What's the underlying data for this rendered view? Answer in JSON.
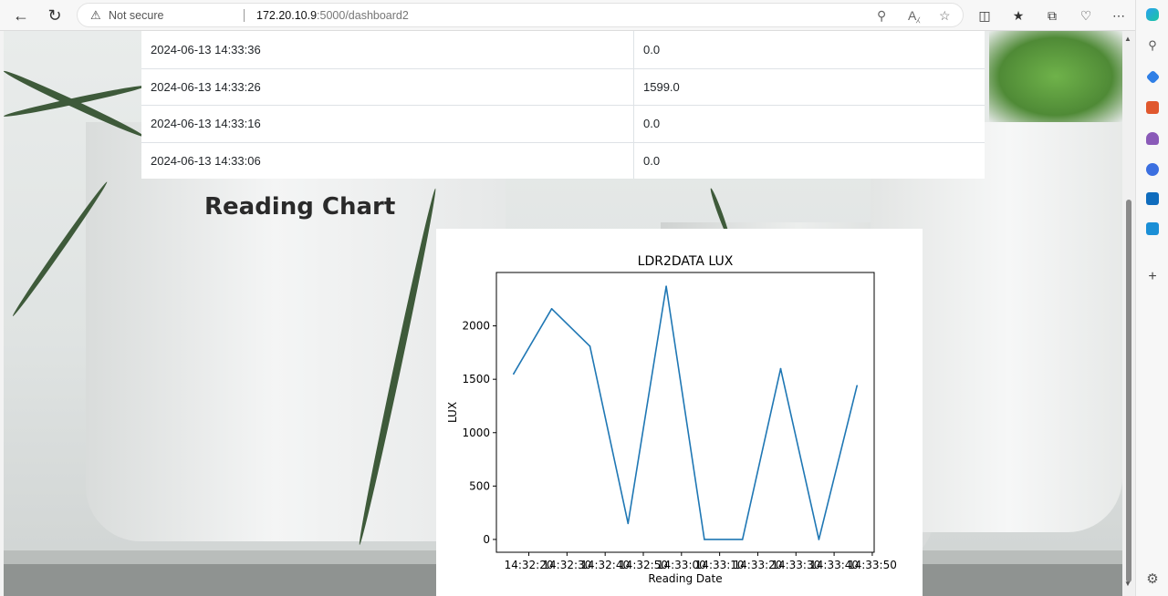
{
  "browser": {
    "security_label": "Not secure",
    "url_host": "172.20.10.9",
    "url_path": ":5000/dashboard2"
  },
  "table": {
    "rows": [
      {
        "date": "2024-06-13 14:33:36",
        "value": "0.0"
      },
      {
        "date": "2024-06-13 14:33:26",
        "value": "1599.0"
      },
      {
        "date": "2024-06-13 14:33:16",
        "value": "0.0"
      },
      {
        "date": "2024-06-13 14:33:06",
        "value": "0.0"
      }
    ]
  },
  "section": {
    "heading": "Reading Chart"
  },
  "chart_data": {
    "type": "line",
    "title": "LDR2DATA LUX",
    "xlabel": "Reading Date",
    "ylabel": "LUX",
    "x_tick_labels": [
      "14:32:20",
      "14:32:30",
      "14:32:40",
      "14:32:50",
      "14:33:00",
      "14:33:10",
      "14:33:20",
      "14:33:30",
      "14:33:40",
      "14:33:50"
    ],
    "y_ticks": [
      0,
      500,
      1000,
      1500,
      2000
    ],
    "ylim": [
      -120,
      2500
    ],
    "series": [
      {
        "color": "#1f77b4",
        "points": [
          {
            "x": "14:32:16",
            "y": 1550
          },
          {
            "x": "14:32:26",
            "y": 2160
          },
          {
            "x": "14:32:36",
            "y": 1810
          },
          {
            "x": "14:32:46",
            "y": 150
          },
          {
            "x": "14:32:56",
            "y": 2370
          },
          {
            "x": "14:33:06",
            "y": 0
          },
          {
            "x": "14:33:16",
            "y": 0
          },
          {
            "x": "14:33:26",
            "y": 1599
          },
          {
            "x": "14:33:36",
            "y": 0
          },
          {
            "x": "14:33:46",
            "y": 1440
          }
        ]
      }
    ]
  }
}
